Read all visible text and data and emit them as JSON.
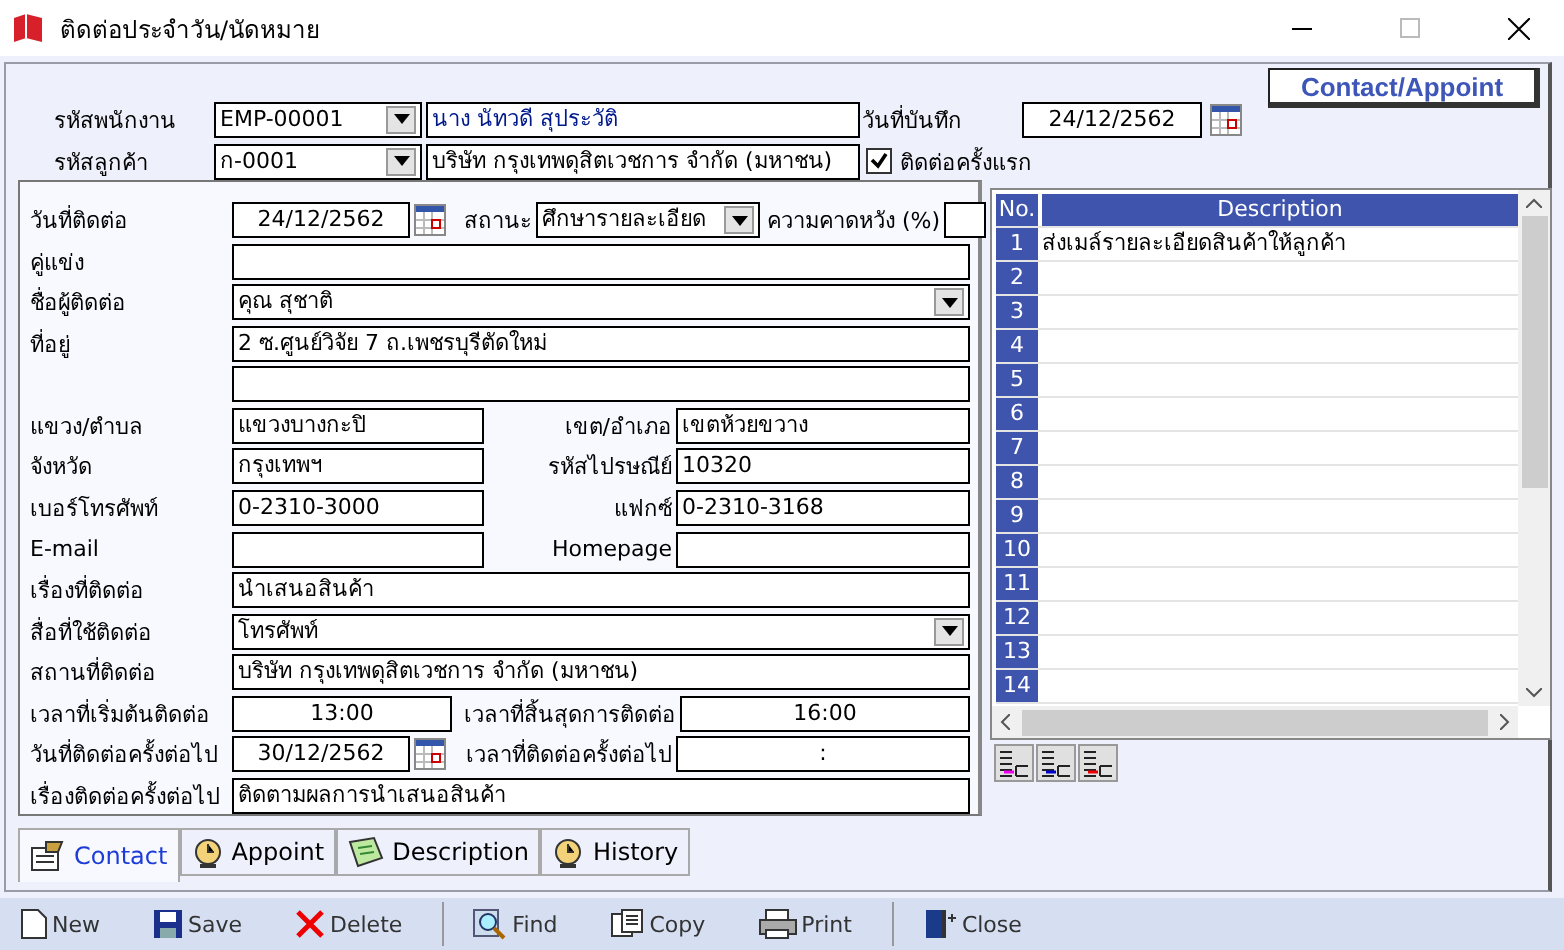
{
  "window": {
    "title": "ติดต่อประจำวัน/นัดหมาย"
  },
  "header": {
    "title_button": "Contact/Appoint",
    "employee": {
      "label": "รหัสพนักงาน",
      "code": "EMP-00001",
      "name": "นาง นัทวดี สุประวัติ"
    },
    "customer": {
      "label": "รหัสลูกค้า",
      "code": "ก-0001",
      "name": "บริษัท กรุงเทพดุสิตเวชการ จำกัด (มหาชน)"
    },
    "record_date": {
      "label": "วันที่บันทึก",
      "value": "24/12/2562"
    },
    "first_contact": {
      "label": "ติดต่อครั้งแรก",
      "checked": true
    }
  },
  "contact": {
    "rows": [
      {
        "kind": "date_status",
        "label": "วันที่ติดต่อ",
        "value": "24/12/2562",
        "status_label": "สถานะ",
        "status": "ศึกษารายละเอียด",
        "expect_label": "ความคาดหวัง (%)"
      },
      {
        "kind": "text",
        "label": "คู่แข่ง"
      },
      {
        "kind": "combo",
        "label": "ชื่อผู้ติดต่อ",
        "value": "คุณ สุชาติ"
      },
      {
        "kind": "text",
        "label": "ที่อยู่",
        "value": "2 ซ.ศูนย์วิจัย 7 ถ.เพชรบุรีตัดใหม่"
      },
      {
        "kind": "text"
      },
      {
        "kind": "pair",
        "label": "แขวง/ตำบล",
        "value": "แขวงบางกะปิ",
        "label2": "เขต/อำเภอ",
        "value2": "เขตห้วยขวาง"
      },
      {
        "kind": "pair",
        "label": "จังหวัด",
        "value": "กรุงเทพฯ",
        "label2": "รหัสไปรษณีย์",
        "value2": "10320"
      },
      {
        "kind": "pair",
        "label": "เบอร์โทรศัพท์",
        "value": "0-2310-3000",
        "label2": "แฟกซ์",
        "value2": "0-2310-3168"
      },
      {
        "kind": "pair",
        "label": "E-mail",
        "label2": "Homepage"
      },
      {
        "kind": "text",
        "label": "เรื่องที่ติดต่อ",
        "value": "นำเสนอสินค้า"
      },
      {
        "kind": "combo",
        "label": "สื่อที่ใช้ติดต่อ",
        "value": "โทรศัพท์"
      },
      {
        "kind": "text",
        "label": "สถานที่ติดต่อ",
        "value": "บริษัท กรุงเทพดุสิตเวชการ จำกัด (มหาชน)"
      },
      {
        "kind": "time_pair",
        "label": "เวลาที่เริ่มต้นติดต่อ",
        "value": "13:00",
        "label2": "เวลาที่สิ้นสุดการติดต่อ",
        "value2": "16:00"
      },
      {
        "kind": "date_pair",
        "label": "วันที่ติดต่อครั้งต่อไป",
        "value": "30/12/2562",
        "label2": "เวลาที่ติดต่อครั้งต่อไป",
        "value2": ":"
      },
      {
        "kind": "text",
        "label": "เรื่องติดต่อครั้งต่อไป",
        "value": "ติดตามผลการนำเสนอสินค้า"
      }
    ]
  },
  "grid": {
    "columns": [
      "No.",
      "Description"
    ],
    "rows": [
      {
        "no": "1",
        "description": "ส่งเมล์รายละเอียดสินค้าให้ลูกค้า"
      },
      {
        "no": "2"
      },
      {
        "no": "3"
      },
      {
        "no": "4"
      },
      {
        "no": "5"
      },
      {
        "no": "6"
      },
      {
        "no": "7"
      },
      {
        "no": "8"
      },
      {
        "no": "9"
      },
      {
        "no": "10"
      },
      {
        "no": "11"
      },
      {
        "no": "12"
      },
      {
        "no": "13"
      },
      {
        "no": "14"
      }
    ]
  },
  "tabs": [
    {
      "label": "Contact",
      "kind": "contact",
      "selected": true
    },
    {
      "label": "Appoint",
      "kind": "clock",
      "selected": false
    },
    {
      "label": "Description",
      "kind": "note",
      "selected": false
    },
    {
      "label": "History",
      "kind": "clock",
      "selected": false
    }
  ],
  "toolbar": [
    {
      "label": "New",
      "kind": "new"
    },
    {
      "label": "Save",
      "kind": "save"
    },
    {
      "label": "Delete",
      "kind": "delete",
      "divider_after": true
    },
    {
      "label": "Find",
      "kind": "find"
    },
    {
      "label": "Copy",
      "kind": "copy"
    },
    {
      "label": "Print",
      "kind": "print",
      "divider_after": true
    },
    {
      "label": "Close",
      "kind": "close"
    }
  ]
}
